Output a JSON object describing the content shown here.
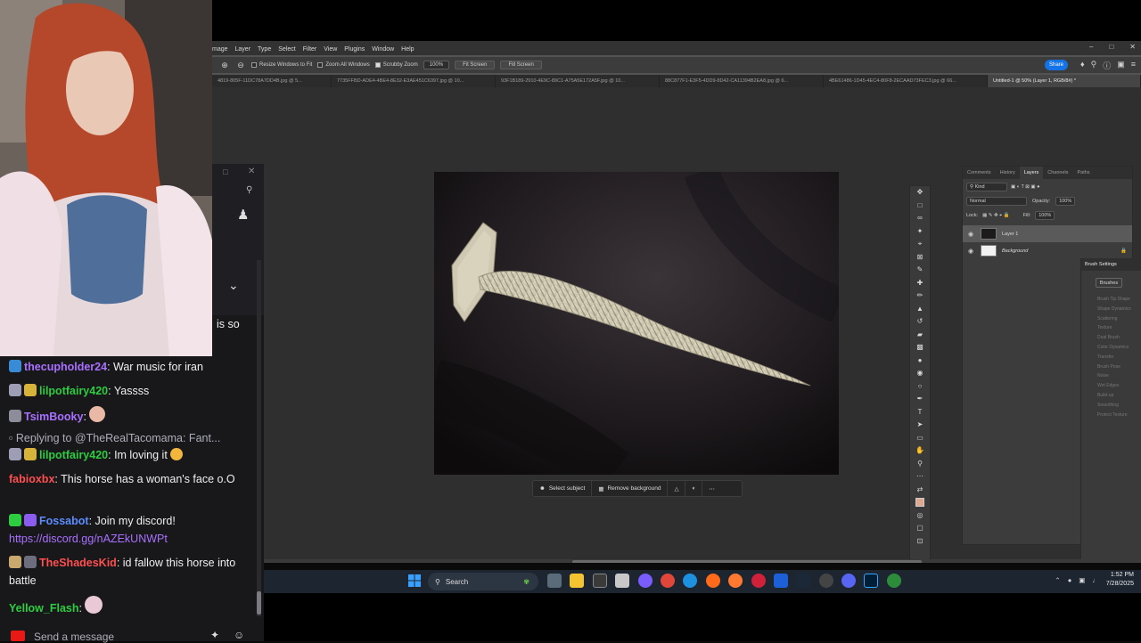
{
  "photoshop": {
    "menu": [
      "mage",
      "Layer",
      "Type",
      "Select",
      "Filter",
      "View",
      "Plugins",
      "Window",
      "Help"
    ],
    "options": {
      "resize_windows": "Resize Windows to Fit",
      "zoom_all": "Zoom All Windows",
      "scrubby_zoom": "Scrubby Zoom",
      "zoom_value": "100%",
      "fit_screen": "Fit Screen",
      "fill_screen": "Fill Screen",
      "share": "Share"
    },
    "tabs": [
      "4819-805F-11DC78A7DD4B.jpg @ 5...",
      "7735FFBD-ADE4-4BE4-8E32-E3AE451C6397.jpg @ 10...",
      "93F1B189-2910-4E9C-89C1-A75A5E172A5F.jpg @ 10...",
      "88C877F1-E3F5-4DD9-8D42-CA11394B2EA8.jpg @ 6...",
      "4BE61486-1D45-4EC4-80F8-2ECAAD73FEC3.jpg @ 66...",
      "Untitled-1 @ 50% (Layer 1, RGB/8#) *"
    ],
    "context_bar": {
      "select_subject": "Select subject",
      "remove_background": "Remove background"
    },
    "layers_panel": {
      "tabs": [
        "Comments",
        "History",
        "Layers",
        "Channels",
        "Paths"
      ],
      "kind": "Kind",
      "blend_mode": "Normal",
      "opacity_label": "Opacity:",
      "opacity_value": "100%",
      "lock_label": "Lock:",
      "fill_label": "Fill:",
      "fill_value": "100%",
      "layers": [
        "Layer 1",
        "Background"
      ]
    },
    "brush_settings": {
      "title": "Brush Settings",
      "brushes_button": "Brushes",
      "options": [
        "Brush Tip Shape",
        "Shape Dynamics",
        "Scattering",
        "Texture",
        "Dual Brush",
        "Color Dynamics",
        "Transfer",
        "Brush Pose",
        "Noise",
        "Wet Edges",
        "Build-up",
        "Smoothing",
        "Protect Texture"
      ]
    }
  },
  "taskbar": {
    "search_label": "Search",
    "time": "1:52 PM",
    "date": "7/28/2025"
  },
  "chat": {
    "partial_text": "is so",
    "messages": [
      {
        "user": "thecupholder24",
        "color": "#a970ff",
        "text": ": War music for iran"
      },
      {
        "user": "lilpotfairy420",
        "color": "#2ecc40",
        "text": ": Yassss"
      },
      {
        "user": "TsimBooky",
        "color": "#a970ff",
        "text": ":"
      },
      {
        "user": "lilpotfairy420",
        "color": "#2ecc40",
        "text": ": Im loving it"
      },
      {
        "user": "fabioxbx",
        "color": "#ff4f4f",
        "text": ": This horse has a woman's face o.O"
      },
      {
        "user": "Fossabot",
        "color": "#5b8cff",
        "text": ": Join my discord!"
      },
      {
        "user": "TheShadesKid",
        "color": "#ff4f4f",
        "text": ": id fallow this horse into battle"
      },
      {
        "user": "Yellow_Flash",
        "color": "#2ecc40",
        "text": ":"
      }
    ],
    "reply_text": "Replying to @TheRealTacomama: Fant...",
    "link": "https://discord.gg/nAZEkUNWPt",
    "input_placeholder": "Send a message"
  }
}
